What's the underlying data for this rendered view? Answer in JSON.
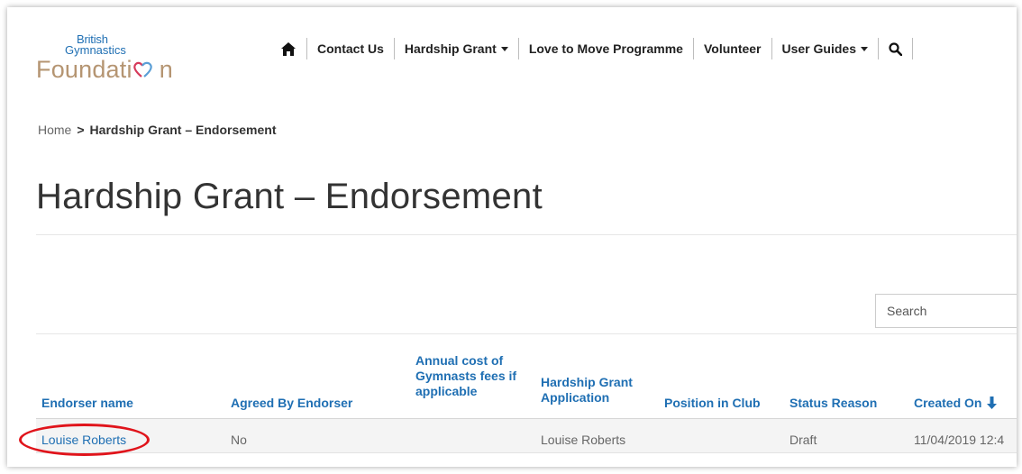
{
  "logo": {
    "line1": "British",
    "line2": "Gymnastics",
    "line3a": "Foundati",
    "line3b": "n"
  },
  "nav": {
    "contact": "Contact Us",
    "hardship": "Hardship Grant",
    "love_to_move": "Love to Move Programme",
    "volunteer": "Volunteer",
    "user_guides": "User Guides"
  },
  "breadcrumb": {
    "home": "Home",
    "separator": ">",
    "current": "Hardship Grant – Endorsement"
  },
  "page_title": "Hardship Grant – Endorsement",
  "search": {
    "placeholder": "Search"
  },
  "table": {
    "headers": {
      "endorser_name": "Endorser name",
      "agreed": "Agreed By Endorser",
      "annual_cost_1": "Annual cost of",
      "annual_cost_2": "Gymnasts fees if",
      "annual_cost_3": "applicable",
      "hardship_app_1": "Hardship Grant",
      "hardship_app_2": "Application",
      "position": "Position in Club",
      "status": "Status Reason",
      "created_on": "Created On"
    },
    "rows": [
      {
        "endorser_name": "Louise Roberts",
        "agreed": "No",
        "annual_cost": "",
        "hardship_app": "Louise Roberts",
        "position": "",
        "status": "Draft",
        "created_on": "11/04/2019 12:4"
      }
    ]
  },
  "colors": {
    "link": "#1f6fb3",
    "logo_blue": "#1f6fb3",
    "logo_gold": "#b59572",
    "highlight": "#e0141b"
  }
}
